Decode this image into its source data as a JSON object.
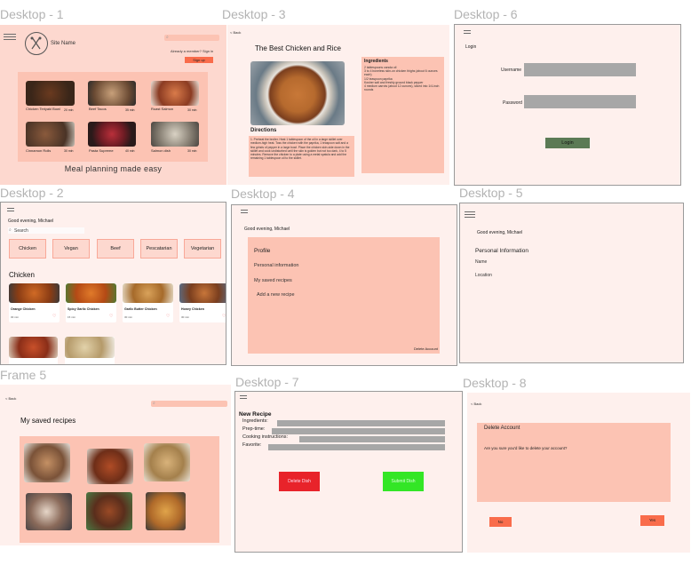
{
  "frame_labels": {
    "d1": "Desktop - 1",
    "d3": "Desktop - 3",
    "d6": "Desktop - 6",
    "d2": "Desktop - 2",
    "d4": "Desktop - 4",
    "d5": "Desktop - 5",
    "f5": "Frame 5",
    "d7": "Desktop - 7",
    "d8": "Desktop - 8"
  },
  "d1": {
    "site_name": "Site Name",
    "member_text": "Already a member? Sign in",
    "signup_label": "Sign up",
    "tagline": "Meal planning made easy",
    "recipes": [
      {
        "name": "Chicken Teriyaki Bowl",
        "time": "20 min"
      },
      {
        "name": "Beef Tacos",
        "time": "35 min"
      },
      {
        "name": "Roast Salmon",
        "time": "30 min"
      },
      {
        "name": "Cinnamon Rolls",
        "time": "30 min"
      },
      {
        "name": "Pasta Supreme",
        "time": "40 min"
      },
      {
        "name": "Salmon dish",
        "time": "30 min"
      }
    ]
  },
  "d3": {
    "back": "< Back",
    "title": "The Best Chicken and Rice",
    "ingredients_heading": "Ingredients",
    "ingredients_text": "2 tablespoons canola oil\n3 to 4 boneless skin-on chicken thighs (about 6 ounces each)\n1/2 teaspoon paprika\nKosher salt and freshly ground black pepper\n4 medium carrots (about 12 ounces), sliced into 1/4-inch rounds",
    "directions_heading": "Directions",
    "directions_text": "1. Preheat the broiler. Heat 1 tablespoon of the oil in a large skillet over medium-high heat. Toss the chicken with the paprika, 1 teaspoon salt and a few grinds of pepper in a large bowl. Place the chicken skin-side down in the skillet and cook undisturbed until the skin is golden but not too dark, 4 to 5 minutes. Remove the chicken to a plate using a metal spatula and add the remaining 1 tablespoon oil to the skillet."
  },
  "d6": {
    "login_heading": "Login",
    "username_label": "Username",
    "password_label": "Password",
    "login_button": "Login"
  },
  "d2": {
    "greeting": "Good evening, Michael",
    "search_placeholder": "Search",
    "categories": [
      "Chicken",
      "Vegan",
      "Beef",
      "Pescatarian",
      "Vegetarian"
    ],
    "section_heading": "Chicken",
    "cards": [
      {
        "name": "Orange Chicken",
        "time": "30 min"
      },
      {
        "name": "Spicy Garlic Chicken",
        "time": "15 min"
      },
      {
        "name": "Garlic Butter Chicken",
        "time": "30 min"
      },
      {
        "name": "Honey Chicken",
        "time": "30 min"
      }
    ]
  },
  "d4": {
    "greeting": "Good evening, Michael",
    "profile_heading": "Profile",
    "items": [
      "Personal information",
      "My saved recipes",
      "Add a new recipe"
    ],
    "delete_account": "Delete Account"
  },
  "d5": {
    "greeting": "Good evening, Michael",
    "section_heading": "Personal Information",
    "name_label": "Name",
    "location_label": "Location"
  },
  "f5": {
    "back": "< Back",
    "title": "My saved recipes"
  },
  "d7": {
    "title": "New Recipe",
    "fields": [
      "Ingredients:",
      "Prep-time:",
      "Cooking instructions:",
      "Favorite:"
    ],
    "delete_button": "Delete Dish",
    "submit_button": "Submit Dish"
  },
  "d8": {
    "back": "< Back",
    "heading": "Delete Account",
    "question": "Are you sure you'd like to delete your account?",
    "no_button": "No",
    "yes_button": "Yes"
  },
  "colors": {
    "peach_frame": "#fdd8cf",
    "salmon_panel": "#fcc3b3",
    "light_frame": "#fef0ed",
    "accent_orange": "#f96c4b",
    "gray_input": "#a7a7a7",
    "login_green": "#5b7a55",
    "delete_red": "#e8232a",
    "submit_green": "#33e626"
  }
}
